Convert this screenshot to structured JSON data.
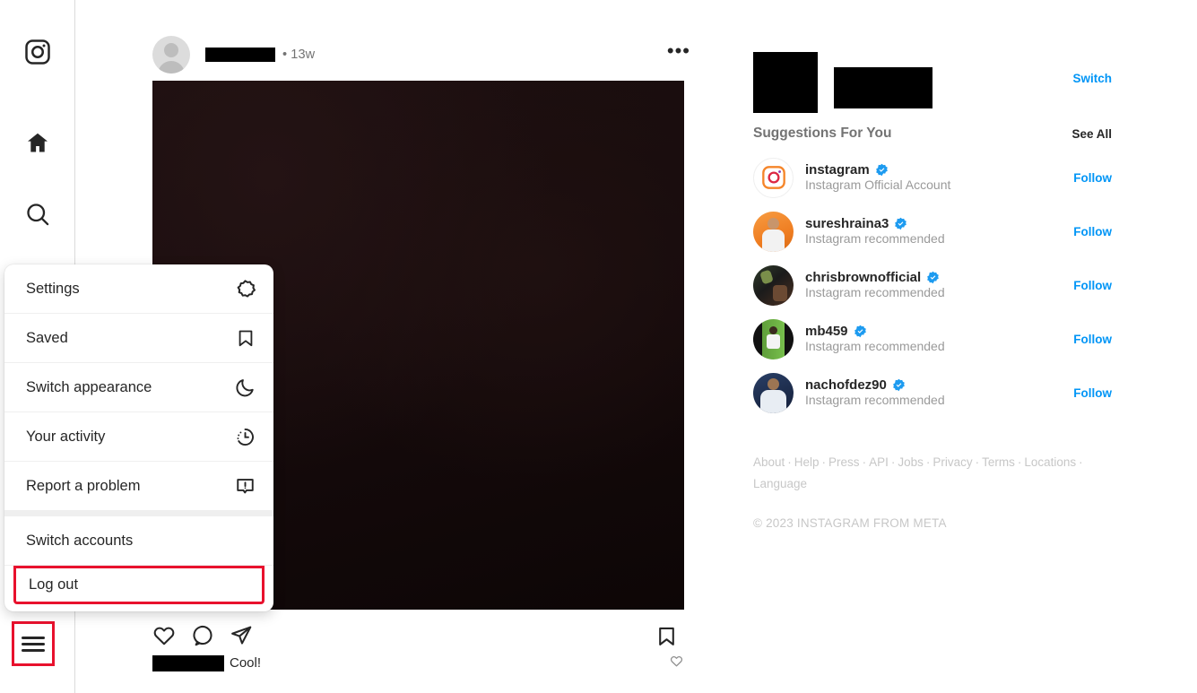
{
  "app": {
    "name": "Instagram"
  },
  "leftnav": {
    "items": [
      {
        "name": "instagram-logo",
        "label": "Instagram"
      },
      {
        "name": "home",
        "label": "Home"
      },
      {
        "name": "search",
        "label": "Search"
      }
    ],
    "more_button_label": "More"
  },
  "menu": {
    "items": [
      {
        "label": "Settings",
        "icon": "gear-icon"
      },
      {
        "label": "Saved",
        "icon": "bookmark-icon"
      },
      {
        "label": "Switch appearance",
        "icon": "moon-icon"
      },
      {
        "label": "Your activity",
        "icon": "activity-clock-icon"
      },
      {
        "label": "Report a problem",
        "icon": "report-problem-icon"
      }
    ],
    "switch_accounts_label": "Switch accounts",
    "logout_label": "Log out",
    "highlight_color": "#e8112d"
  },
  "post": {
    "username_redacted": true,
    "time_ago": "• 13w",
    "more_options": "•••",
    "actions": {
      "like": "Like",
      "comment": "Comment",
      "share": "Share",
      "save": "Save"
    },
    "comment": {
      "author_redacted": true,
      "text": "Cool!"
    }
  },
  "sidebar": {
    "account": {
      "avatar_redacted": true,
      "name_redacted": true,
      "switch_label": "Switch"
    },
    "suggestions_title": "Suggestions For You",
    "see_all_label": "See All",
    "follow_label": "Follow",
    "suggestions": [
      {
        "username": "instagram",
        "subtitle": "Instagram Official Account",
        "verified": true,
        "avatar": "instagram-logo"
      },
      {
        "username": "sureshraina3",
        "subtitle": "Instagram recommended",
        "verified": true,
        "avatar": "orange-portrait"
      },
      {
        "username": "chrisbrownofficial",
        "subtitle": "Instagram recommended",
        "verified": true,
        "avatar": "dark-portrait"
      },
      {
        "username": "mb459",
        "subtitle": "Instagram recommended",
        "verified": true,
        "avatar": "green-pitch-portrait"
      },
      {
        "username": "nachofdez90",
        "subtitle": "Instagram recommended",
        "verified": true,
        "avatar": "blue-portrait"
      }
    ],
    "footer_links": [
      "About",
      "Help",
      "Press",
      "API",
      "Jobs",
      "Privacy",
      "Terms",
      "Locations",
      "Language"
    ],
    "copyright": "© 2023 INSTAGRAM FROM META"
  },
  "colors": {
    "accent_blue": "#0095f6",
    "text_primary": "#262626",
    "text_muted": "#737373",
    "highlight_red": "#e8112d"
  }
}
